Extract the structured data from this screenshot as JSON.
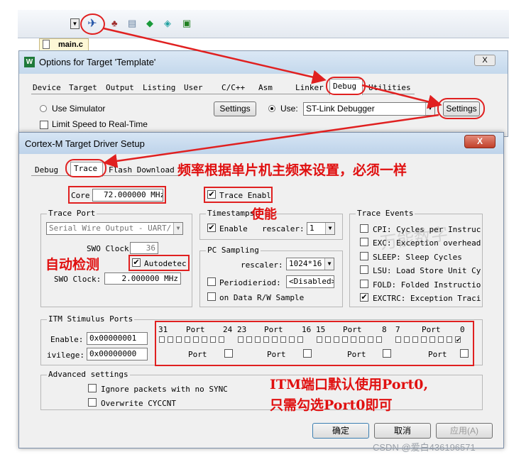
{
  "file_tab": "main.c",
  "options_dialog": {
    "title": "Options for Target 'Template'",
    "close_glyph": "X",
    "tabs": [
      "Device",
      "Target",
      "Output",
      "Listing",
      "User",
      "C/C++",
      "Asm",
      "Linker",
      "Debug",
      "Utilities"
    ],
    "use_simulator": "Use Simulator",
    "limit_speed": "Limit Speed to Real-Time",
    "settings_left": "Settings",
    "use_label": "Use:",
    "debugger": "ST-Link Debugger",
    "settings_right": "Settings"
  },
  "driver_dialog": {
    "title": "Cortex-M Target Driver Setup",
    "close_glyph": "X",
    "tabs": [
      "Debug",
      "Trace",
      "Flash Download"
    ],
    "core_label": "Core",
    "core_value": "72.000000",
    "core_unit": "MHz",
    "trace_enable": "Trace Enabl",
    "trace_port": {
      "title": "Trace Port",
      "value": "Serial Wire Output - UART/",
      "swo_clock_label": "SWO Clock",
      "swo_clock_value": "36",
      "autodetect": "Autodetec",
      "swo_clock2_label": "SWO Clock:",
      "swo_clock2_value": "2.000000 MHz"
    },
    "timestamps": {
      "title": "Timestamps",
      "enable": "Enable",
      "prescaler": "rescaler:",
      "value": "1"
    },
    "pc_sampling": {
      "title": "PC Sampling",
      "prescaler": "rescaler:",
      "value": "1024*16",
      "periodic": "Periodi",
      "period_label": "eriod:",
      "period_value": "<Disabled>",
      "on_data": "on Data R/W Sample"
    },
    "trace_events": {
      "title": "Trace Events",
      "items": [
        {
          "label": "CPI: Cycles per Instruc",
          "checked": false
        },
        {
          "label": "EXC: Exception overhead",
          "checked": false
        },
        {
          "label": "SLEEP: Sleep Cycles",
          "checked": false
        },
        {
          "label": "LSU: Load Store Unit Cy",
          "checked": false
        },
        {
          "label": "FOLD: Folded Instructio",
          "checked": false
        },
        {
          "label": "EXCTRC: Exception Traci",
          "checked": true
        }
      ]
    },
    "itm": {
      "title": "ITM Stimulus Ports",
      "enable_label": "Enable:",
      "enable_value": "0x00000001",
      "privilege_label": "ivilege:",
      "privilege_value": "0x00000000",
      "headers": [
        {
          "hi": "31",
          "lo": "24",
          "port": "Port"
        },
        {
          "hi": "23",
          "lo": "16",
          "port": "Port"
        },
        {
          "hi": "15",
          "lo": "8",
          "port": "Port"
        },
        {
          "hi": "7",
          "lo": "0",
          "port": "Port"
        }
      ],
      "priv_port": "Port"
    },
    "advanced": {
      "title": "Advanced settings",
      "ignore": "Ignore packets with no SYNC",
      "overwrite": "Overwrite CYCCNT"
    },
    "buttons": {
      "ok": "确定",
      "cancel": "取消",
      "apply": "应用(A)"
    }
  },
  "annotations": {
    "freq": "频率根据单片机主频来设置，必须一样",
    "enable": "使能",
    "auto": "自动检测",
    "itm1": "ITM端口默认使用Port0,",
    "itm2": "只需勾选Port0即可"
  },
  "watermark": "CSDN @爱白436196571",
  "watermark_center": "万能数字",
  "colors": {
    "annotation": "#e01010",
    "dialog_bg": "#f0f0f0",
    "title_blue": "#c9dff2"
  }
}
